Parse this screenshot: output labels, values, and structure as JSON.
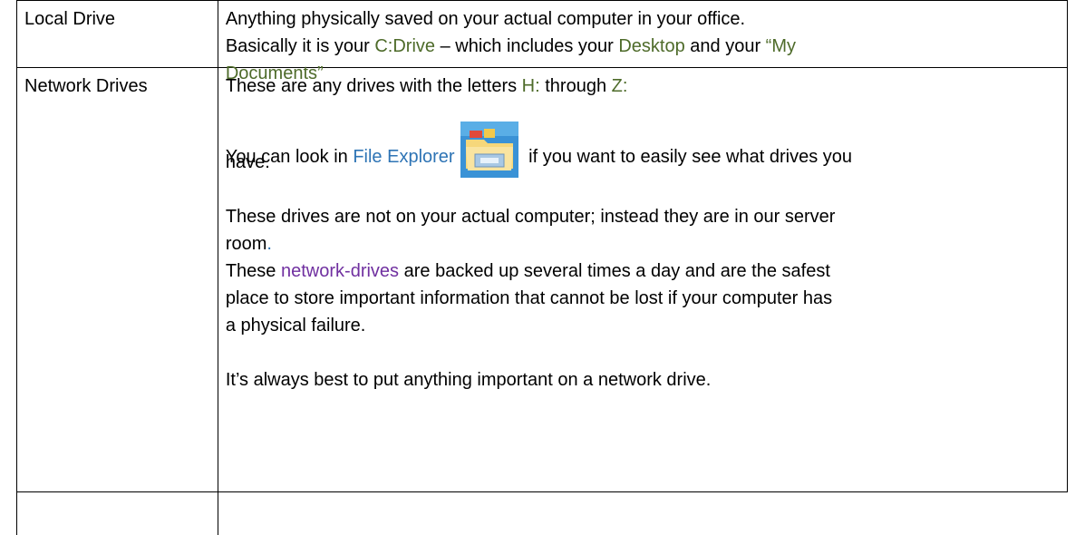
{
  "table": {
    "rows": [
      {
        "term": "Local Drive",
        "line1": "Anything physically saved on your actual computer in your office.",
        "line2_prefix": "Basically it is your ",
        "line2_cdrive": "C:Drive",
        "line2_mid": " – which includes your ",
        "line2_desktop": "Desktop",
        "line2_and": " and your ",
        "line2_mydocs_open": "“My",
        "line3_documents": "Documents”"
      },
      {
        "term": "Network Drives",
        "letters_prefix": "These are any drives with the letters ",
        "letter_h": "H:",
        "letters_through": " through ",
        "letter_z": "Z:",
        "explorer_prefix": "You can look in ",
        "explorer_link": "File Explorer",
        "explorer_suffix": " if you want to easily see what drives you",
        "explorer_wrap": "have.",
        "server_line1": "These drives are not on your actual computer; instead they are in our server",
        "server_line2_text": "room",
        "server_line2_dot": ".",
        "network_term": "network-drives",
        "backup_line1_prefix": "These ",
        "backup_line1_suffix": " are backed up several times a day and are the safest",
        "backup_line2": "place to store important information that cannot be lost if your computer has",
        "backup_line3": "a physical failure.",
        "best_line": "It’s always best to put anything important on a network drive."
      }
    ],
    "icon": "file-explorer-icon",
    "colors": {
      "green": "#4e6b2a",
      "blue": "#2e74b5",
      "purple": "#7030a0"
    }
  }
}
